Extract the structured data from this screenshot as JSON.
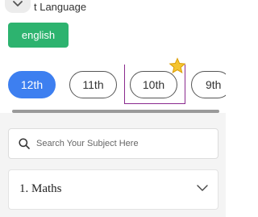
{
  "section": {
    "title_visible": "t Language"
  },
  "language": {
    "selected_label": "english"
  },
  "grades": [
    {
      "label": "12th",
      "active": true
    },
    {
      "label": "11th",
      "active": false
    },
    {
      "label": "10th",
      "active": false
    },
    {
      "label": "9th",
      "active": false
    }
  ],
  "search": {
    "placeholder": "Search Your Subject Here",
    "value": ""
  },
  "subjects": [
    {
      "label": "1. Maths"
    }
  ],
  "colors": {
    "language_button": "#2db36f",
    "active_grade": "#3d7ff0",
    "highlight_box": "#8a2a8e",
    "star": "#f4c430"
  }
}
